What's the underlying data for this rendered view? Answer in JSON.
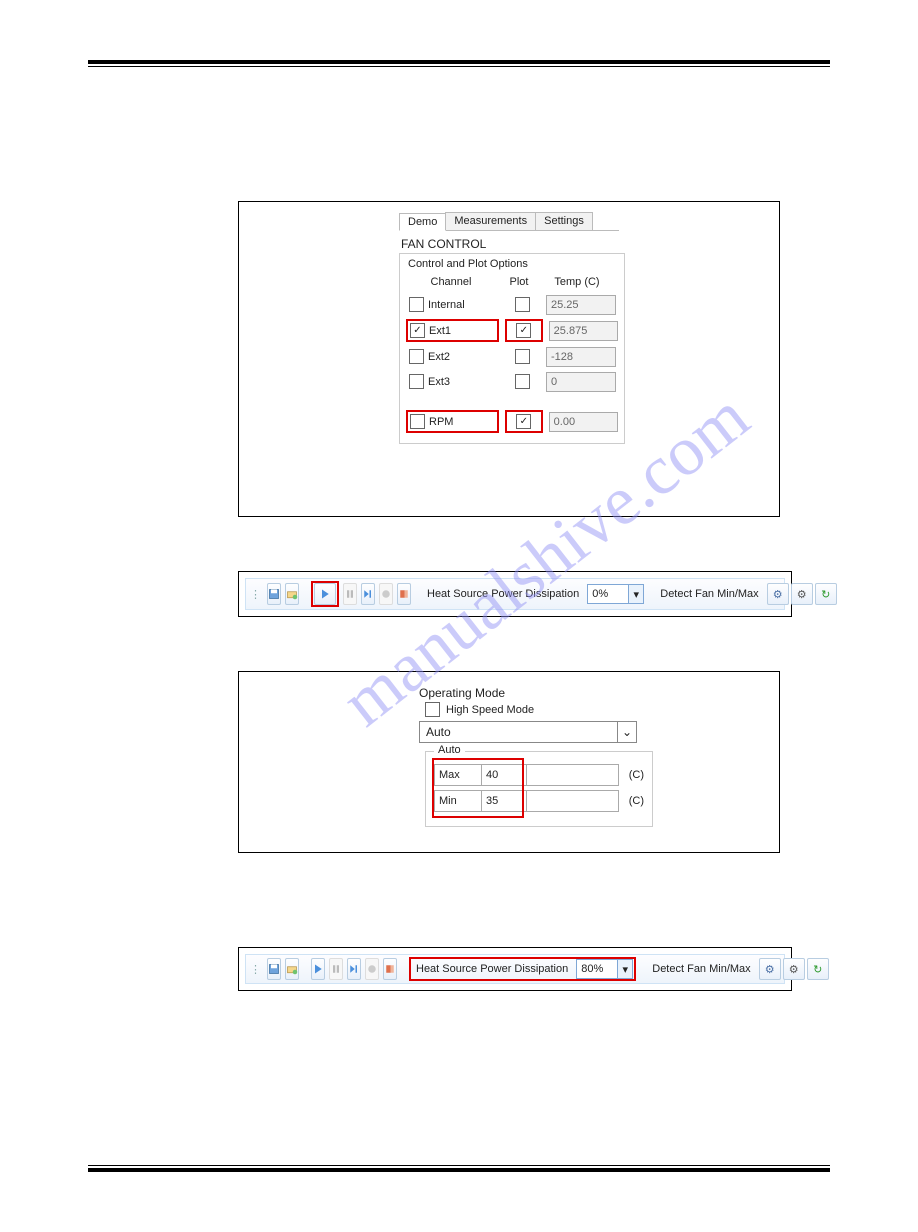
{
  "watermark": "manualshive.com",
  "fig1": {
    "tabs": {
      "demo": "Demo",
      "meas": "Measurements",
      "settings": "Settings"
    },
    "title": "FAN CONTROL",
    "group_title": "Control and Plot Options",
    "headers": {
      "channel": "Channel",
      "plot": "Plot",
      "temp": "Temp (C)"
    },
    "rows": {
      "internal": {
        "label": "Internal",
        "ch_checked": false,
        "plot_checked": false,
        "temp": "25.25"
      },
      "ext1": {
        "label": "Ext1",
        "ch_checked": true,
        "plot_checked": true,
        "temp": "25.875"
      },
      "ext2": {
        "label": "Ext2",
        "ch_checked": false,
        "plot_checked": false,
        "temp": "-128"
      },
      "ext3": {
        "label": "Ext3",
        "ch_checked": false,
        "plot_checked": false,
        "temp": "0"
      },
      "rpm": {
        "label": "RPM",
        "ch_checked": false,
        "plot_checked": true,
        "temp": "0.00"
      }
    }
  },
  "toolbar": {
    "heat_label": "Heat Source Power Dissipation",
    "detect_label": "Detect Fan Min/Max",
    "value_a": "0%",
    "value_b": "80%"
  },
  "fig3": {
    "op_title": "Operating Mode",
    "high_speed_label": "High Speed Mode",
    "high_speed_checked": false,
    "mode_value": "Auto",
    "auto_legend": "Auto",
    "max_label": "Max",
    "max_value": "40",
    "min_label": "Min",
    "min_value": "35",
    "unit": "(C)"
  }
}
